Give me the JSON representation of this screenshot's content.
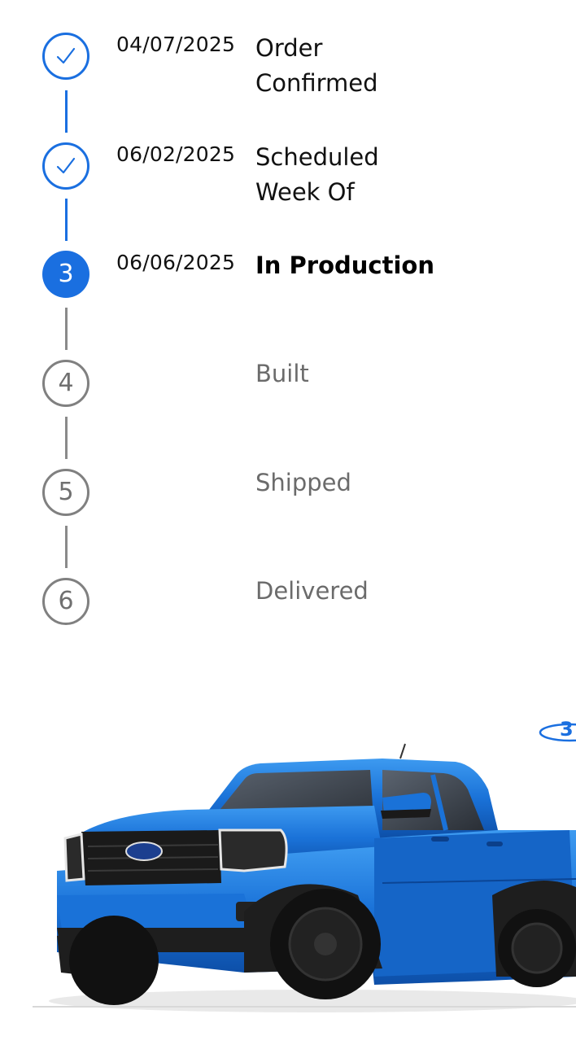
{
  "timeline": {
    "steps": [
      {
        "state": "done",
        "icon": "check-icon",
        "date": "04/07/2025",
        "label": "Order\nConfirmed"
      },
      {
        "state": "done",
        "icon": "check-icon",
        "date": "06/02/2025",
        "label": "Scheduled\nWeek Of"
      },
      {
        "state": "current",
        "number": "3",
        "date": "06/06/2025",
        "label": "In Production"
      },
      {
        "state": "todo",
        "number": "4",
        "date": "",
        "label": "Built"
      },
      {
        "state": "todo",
        "number": "5",
        "date": "",
        "label": "Shipped"
      },
      {
        "state": "todo",
        "number": "6",
        "date": "",
        "label": "Delivered"
      }
    ]
  },
  "vehicle": {
    "badge_text": "3",
    "color": "#1a72d8"
  },
  "colors": {
    "accent": "#1a6fe0",
    "pending": "#808080"
  }
}
